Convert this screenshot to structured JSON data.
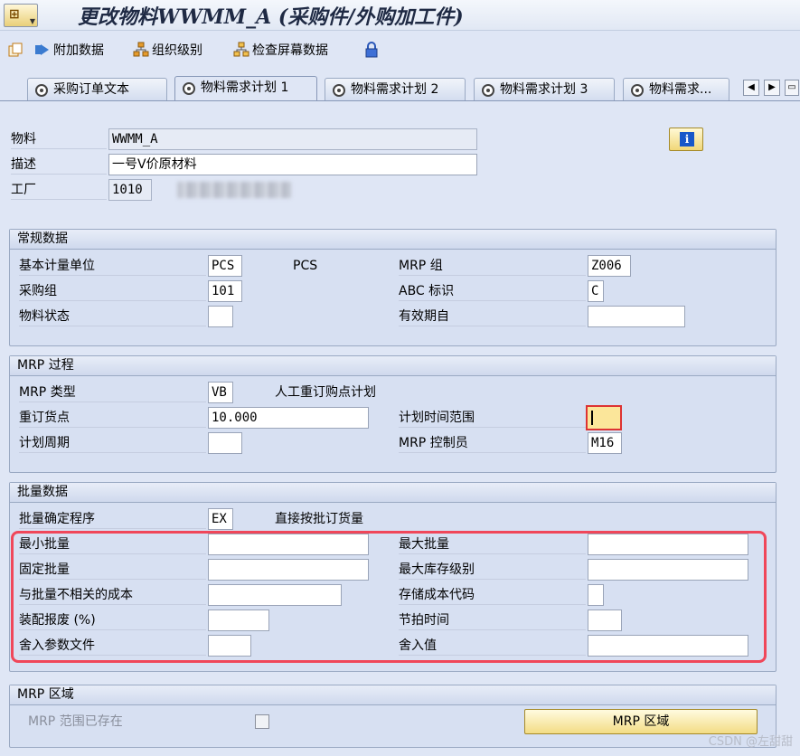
{
  "window": {
    "title": "更改物料WWMM_A (采购件/外购加工件)"
  },
  "toolbar": {
    "additional_data": "附加数据",
    "org_levels": "组织级别",
    "check_screen_data": "检查屏幕数据"
  },
  "tabs": [
    {
      "label": "采购订单文本"
    },
    {
      "label": "物料需求计划 1"
    },
    {
      "label": "物料需求计划 2"
    },
    {
      "label": "物料需求计划 3"
    },
    {
      "label": "物料需求..."
    }
  ],
  "header": {
    "material_label": "物料",
    "material_value": "WWMM_A",
    "description_label": "描述",
    "description_value": "一号V价原材料",
    "plant_label": "工厂",
    "plant_value": "1010"
  },
  "general": {
    "title": "常规数据",
    "base_uom_label": "基本计量单位",
    "base_uom_value": "PCS",
    "base_uom_text": "PCS",
    "mrp_group_label": "MRP 组",
    "mrp_group_value": "Z006",
    "purch_group_label": "采购组",
    "purch_group_value": "101",
    "abc_label": "ABC 标识",
    "abc_value": "C",
    "mat_status_label": "物料状态",
    "mat_status_value": "",
    "valid_from_label": "有效期自",
    "valid_from_value": ""
  },
  "mrp_procedure": {
    "title": "MRP 过程",
    "mrp_type_label": "MRP 类型",
    "mrp_type_value": "VB",
    "mrp_type_text": "人工重订购点计划",
    "reorder_label": "重订货点",
    "reorder_value": "10.000",
    "horizon_label": "计划时间范围",
    "horizon_value": "",
    "cycle_label": "计划周期",
    "cycle_value": "",
    "controller_label": "MRP 控制员",
    "controller_value": "M16"
  },
  "lot_size": {
    "title": "批量数据",
    "procedure_label": "批量确定程序",
    "procedure_value": "EX",
    "procedure_text": "直接按批订货量",
    "min_lot_label": "最小批量",
    "min_lot_value": "",
    "max_lot_label": "最大批量",
    "max_lot_value": "",
    "fixed_lot_label": "固定批量",
    "fixed_lot_value": "",
    "max_stock_label": "最大库存级别",
    "max_stock_value": "",
    "lot_cost_label": "与批量不相关的成本",
    "lot_cost_value": "",
    "storage_cost_label": "存储成本代码",
    "storage_cost_value": "",
    "assembly_scrap_label": "装配报废 (%)",
    "assembly_scrap_value": "",
    "takt_label": "节拍时间",
    "takt_value": "",
    "rounding_profile_label": "舍入参数文件",
    "rounding_profile_value": "",
    "rounding_value_label": "舍入值",
    "rounding_value_value": ""
  },
  "mrp_area": {
    "title": "MRP 区域",
    "exists_label": "MRP 范围已存在",
    "button_label": "MRP 区域"
  },
  "watermark": "CSDN @左甜甜"
}
